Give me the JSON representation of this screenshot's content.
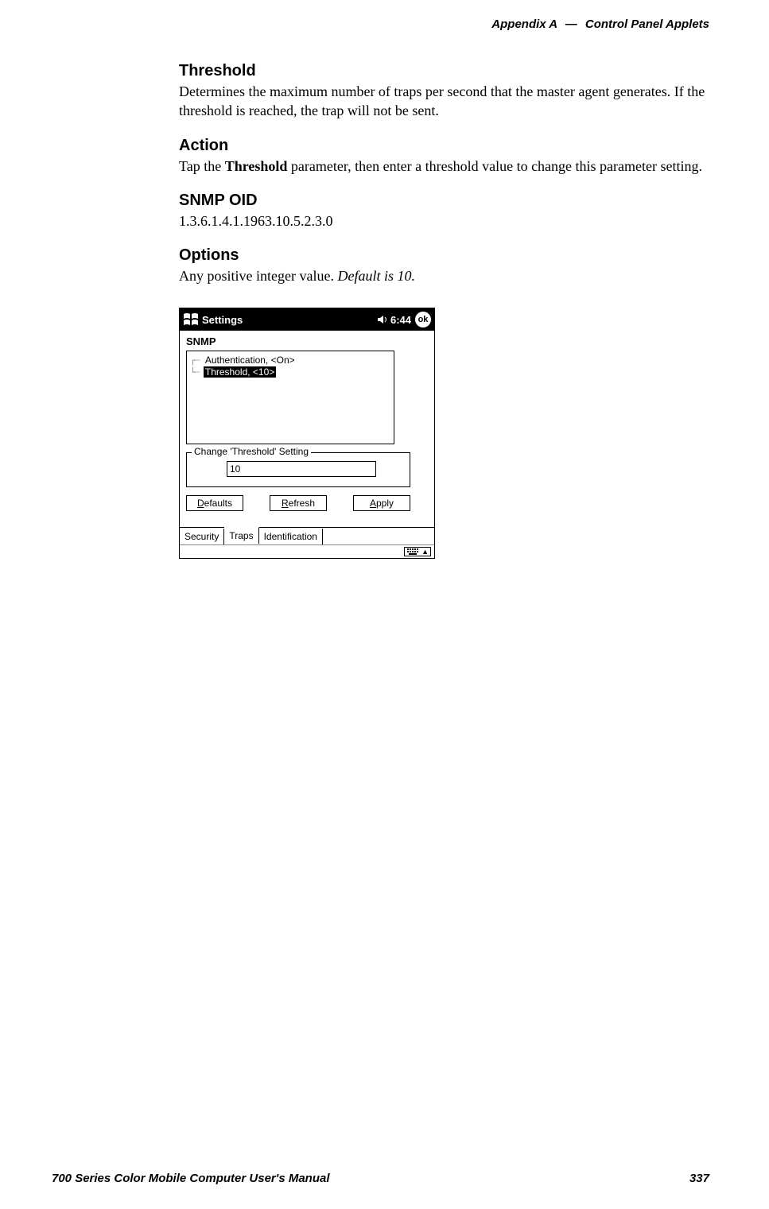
{
  "header": {
    "appendix": "Appendix A",
    "dash": "—",
    "title": "Control Panel Applets"
  },
  "sections": {
    "threshold": {
      "heading": "Threshold",
      "text": "Determines the maximum number of traps per second that the master agent generates. If the threshold is reached, the trap will not be sent."
    },
    "action": {
      "heading": "Action",
      "text_pre": "Tap the ",
      "text_bold": "Threshold",
      "text_post": " parameter, then enter a threshold value to change this parameter setting."
    },
    "snmp": {
      "heading": "SNMP OID",
      "text": "1.3.6.1.4.1.1963.10.5.2.3.0"
    },
    "options": {
      "heading": "Options",
      "text_main": "Any positive integer value. ",
      "text_italic": "Default is 10."
    }
  },
  "screenshot": {
    "bar": {
      "title": "Settings",
      "time": "6:44",
      "ok": "ok"
    },
    "app_title": "SNMP",
    "tree": {
      "item1": "Authentication, <On>",
      "item2": "Threshold, <10>"
    },
    "fieldset_label": "Change 'Threshold' Setting",
    "input_value": "10",
    "buttons": {
      "defaults": "efaults",
      "refresh": "efresh",
      "apply": "pply"
    },
    "tabs": {
      "security": "Security",
      "traps": "Traps",
      "identification": "Identification"
    }
  },
  "footer": {
    "manual": "700 Series Color Mobile Computer User's Manual",
    "page": "337"
  }
}
